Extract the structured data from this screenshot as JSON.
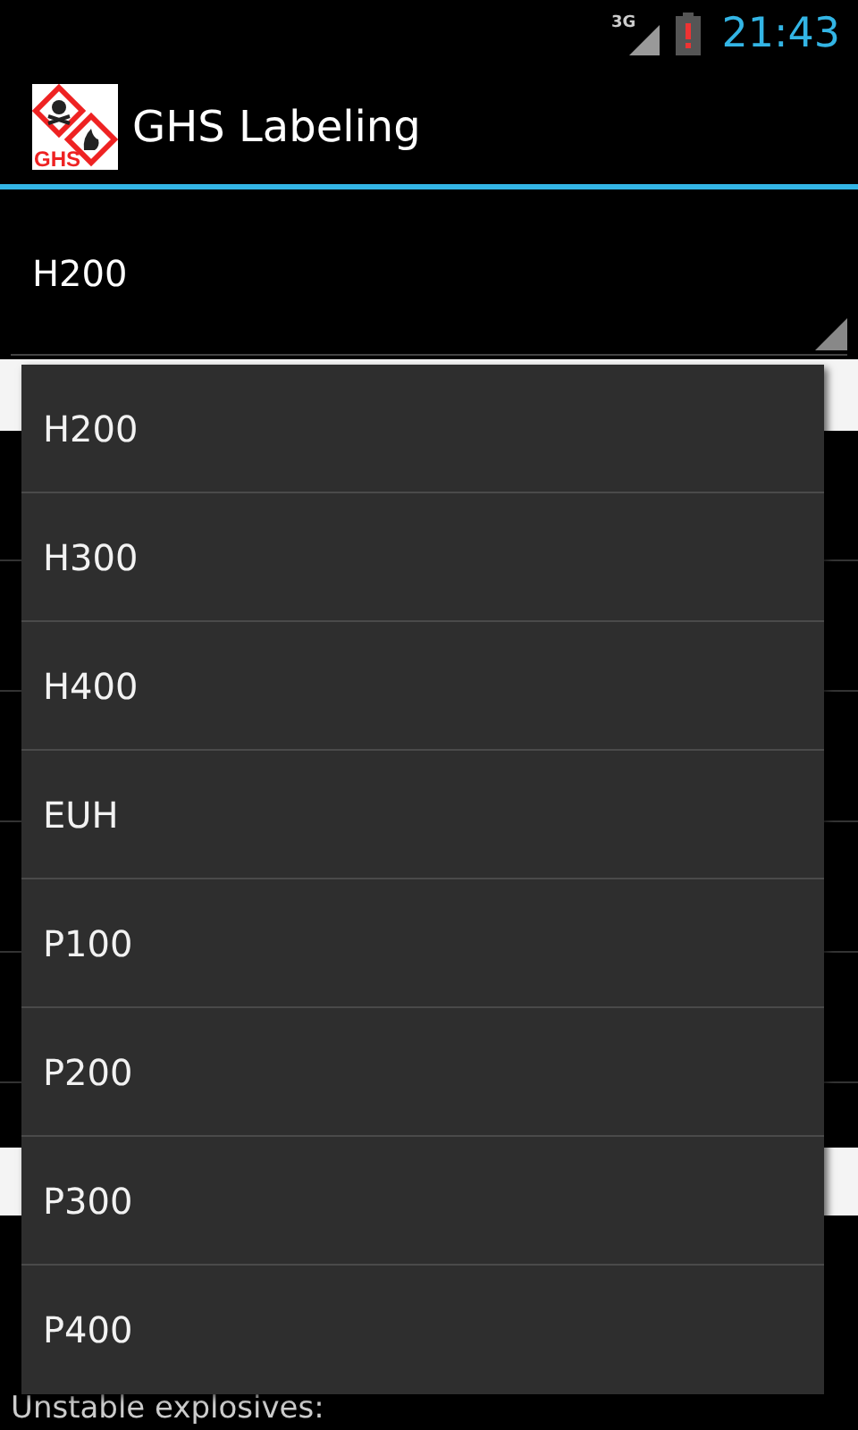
{
  "status_bar": {
    "network": "3G",
    "time": "21:43"
  },
  "action_bar": {
    "logo_text": "GHS",
    "title": "GHS Labeling"
  },
  "spinner": {
    "value": "H200"
  },
  "background": {
    "lines": [
      {
        "kind": "body",
        "text": "Unstable explosives:"
      }
    ]
  },
  "dropdown": {
    "items": [
      "H200",
      "H300",
      "H400",
      "EUH",
      "P100",
      "P200",
      "P300",
      "P400"
    ]
  }
}
